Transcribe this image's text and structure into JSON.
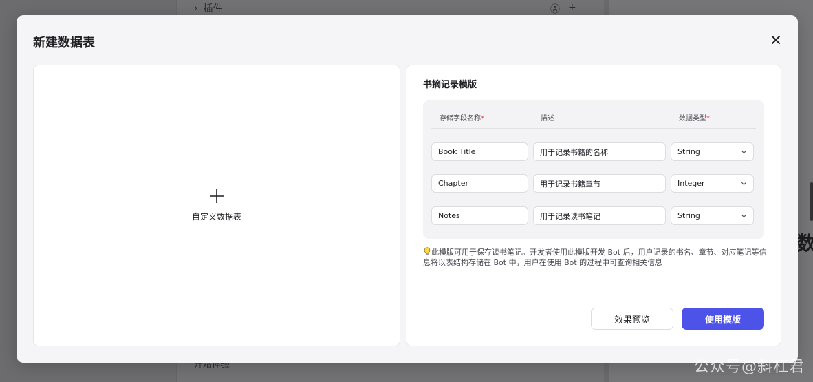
{
  "background": {
    "plugin_label": "插件",
    "bottom_text": "开始体验",
    "right_glyph": "数",
    "watermark": "公众号@斜杠君"
  },
  "modal": {
    "title": "新建数据表",
    "custom_table_label": "自定义数据表",
    "template": {
      "title": "书摘记录模版",
      "columns": {
        "field_name": "存储字段名称",
        "description": "描述",
        "data_type": "数据类型",
        "required_mark": "*"
      },
      "rows": [
        {
          "name": "Book Title",
          "description": "用于记录书籍的名称",
          "type": "String"
        },
        {
          "name": "Chapter",
          "description": "用于记录书籍章节",
          "type": "Integer"
        },
        {
          "name": "Notes",
          "description": "用于记录读书笔记",
          "type": "String"
        }
      ],
      "hint": "此模版可用于保存读书笔记。开发者使用此模版开发 Bot 后，用户记录的书名、章节、对应笔记等信息将以表结构存储在 Bot 中，用户在使用 Bot 的过程中可查询相关信息"
    },
    "buttons": {
      "preview": "效果预览",
      "use_template": "使用模版"
    },
    "accent_color": "#4d53e8"
  }
}
